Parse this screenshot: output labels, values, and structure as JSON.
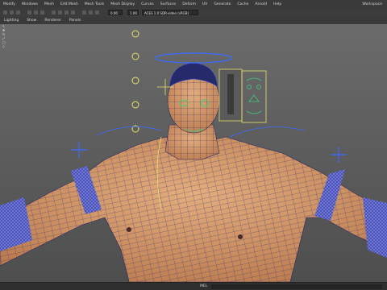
{
  "menu": {
    "items": [
      "Modify",
      "Windows",
      "Mesh",
      "Edit Mesh",
      "Mesh Tools",
      "Mesh Display",
      "Curves",
      "Surfaces",
      "Deform",
      "UV",
      "Generate",
      "Cache",
      "Arnold",
      "Help"
    ],
    "workspace": "Workspace"
  },
  "shelf": {
    "field1": "0.00",
    "field2": "1.00",
    "camera": "ACES 1.0 SDR-video (sRGB)"
  },
  "panel_menu": [
    "Lighting",
    "Show",
    "Renderer",
    "Panels"
  ],
  "viewport": {
    "tools": [
      "↖",
      "✥",
      "↻",
      "⤢",
      "▢",
      "◇"
    ]
  },
  "status": {
    "mel_label": "MEL"
  },
  "colors": {
    "menubar": "#3a3a3a",
    "viewport_top": "#6b6b6b",
    "viewport_bottom": "#4e4e4e",
    "skin": "#d49a6a",
    "wire_dark": "#3c3470",
    "wire_light": "#e0c08a",
    "controls_blue": "#3a6cff",
    "controls_yellow": "#e6e36a",
    "controls_green": "#3fd07a",
    "bands": "#4a52b8"
  }
}
